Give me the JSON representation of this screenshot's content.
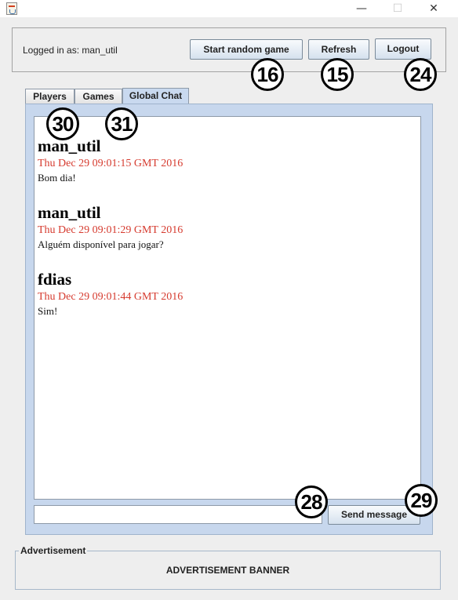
{
  "window": {
    "minimize_glyph": "—",
    "maximize_glyph": "☐",
    "close_glyph": "✕"
  },
  "header": {
    "logged_in_text": "Logged in as: man_util",
    "start_random_label": "Start random game",
    "refresh_label": "Refresh",
    "logout_label": "Logout"
  },
  "badges": {
    "start_random": "16",
    "refresh": "15",
    "logout": "24",
    "tab_players": "30",
    "tab_games": "31",
    "message_input": "28",
    "send": "29"
  },
  "tabs": [
    {
      "label": "Players"
    },
    {
      "label": "Games"
    },
    {
      "label": "Global Chat",
      "selected": true
    }
  ],
  "chat": {
    "messages": [
      {
        "author": "man_util",
        "time": "Thu Dec 29 09:01:15 GMT 2016",
        "text": "Bom dia!"
      },
      {
        "author": "man_util",
        "time": "Thu Dec 29 09:01:29 GMT 2016",
        "text": "Alguém disponível para jogar?"
      },
      {
        "author": "fdias",
        "time": "Thu Dec 29 09:01:44 GMT 2016",
        "text": "Sim!"
      }
    ],
    "input_value": "",
    "send_label": "Send message"
  },
  "advertisement": {
    "title": "Advertisement",
    "banner": "ADVERTISEMENT BANNER"
  },
  "colors": {
    "timestamp": "#d63b2f",
    "tab_panel": "#c7d7ed",
    "button_gradient_bottom": "#d5e1ee"
  }
}
